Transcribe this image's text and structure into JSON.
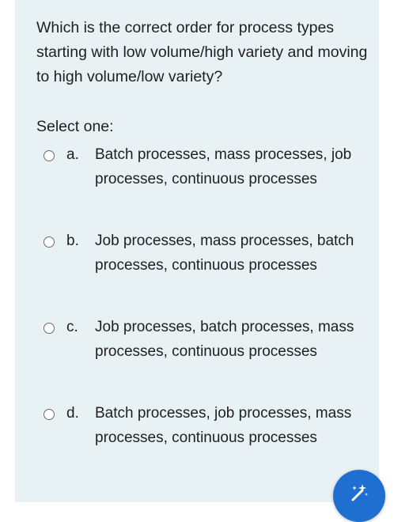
{
  "quiz": {
    "question": "Which is the correct order for process types starting with low volume/high variety and moving to high volume/low variety?",
    "prompt": "Select one:",
    "options": [
      {
        "letter": "a.",
        "text": "Batch processes, mass processes, job processes, continuous processes"
      },
      {
        "letter": "b.",
        "text": "Job processes, mass processes, batch processes, continuous processes"
      },
      {
        "letter": "c.",
        "text": "Job processes, batch processes, mass processes, continuous processes"
      },
      {
        "letter": "d.",
        "text": "Batch processes, job processes, mass processes, continuous processes"
      }
    ]
  },
  "fab": {
    "icon": "magic-wand-icon",
    "color": "#1f6fd0"
  },
  "colors": {
    "card_background": "#e8f2f4",
    "text": "#1f1f1f"
  }
}
